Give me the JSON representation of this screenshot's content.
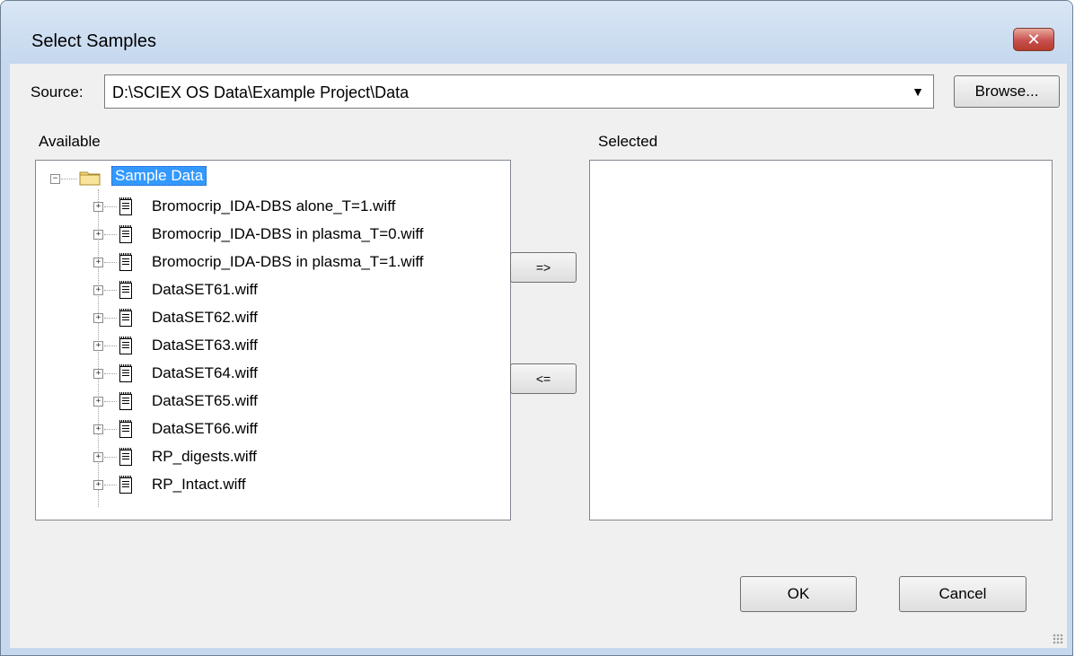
{
  "window": {
    "title": "Select Samples",
    "close_glyph": "✕"
  },
  "source": {
    "label": "Source:",
    "value": "D:\\SCIEX OS Data\\Example Project\\Data",
    "dropdown_glyph": "▼",
    "browse_label": "Browse..."
  },
  "available": {
    "label": "Available",
    "root": {
      "label": "Sample Data",
      "expander": "−",
      "icon": "folder-icon"
    },
    "items": [
      {
        "label": "Bromocrip_IDA-DBS alone_T=1.wiff",
        "expander": "+",
        "icon": "file-icon"
      },
      {
        "label": "Bromocrip_IDA-DBS in plasma_T=0.wiff",
        "expander": "+",
        "icon": "file-icon"
      },
      {
        "label": "Bromocrip_IDA-DBS in plasma_T=1.wiff",
        "expander": "+",
        "icon": "file-icon"
      },
      {
        "label": "DataSET61.wiff",
        "expander": "+",
        "icon": "file-icon"
      },
      {
        "label": "DataSET62.wiff",
        "expander": "+",
        "icon": "file-icon"
      },
      {
        "label": "DataSET63.wiff",
        "expander": "+",
        "icon": "file-icon"
      },
      {
        "label": "DataSET64.wiff",
        "expander": "+",
        "icon": "file-icon"
      },
      {
        "label": "DataSET65.wiff",
        "expander": "+",
        "icon": "file-icon"
      },
      {
        "label": "DataSET66.wiff",
        "expander": "+",
        "icon": "file-icon"
      },
      {
        "label": "RP_digests.wiff",
        "expander": "+",
        "icon": "file-icon"
      },
      {
        "label": "RP_Intact.wiff",
        "expander": "+",
        "icon": "file-icon"
      }
    ]
  },
  "selected": {
    "label": "Selected",
    "items": []
  },
  "transfer": {
    "add_label": "=>",
    "remove_label": "<="
  },
  "footer": {
    "ok_label": "OK",
    "cancel_label": "Cancel"
  },
  "colors": {
    "selection": "#3399ff",
    "close_button": "#c75050",
    "frame": "#c5d8ee"
  }
}
